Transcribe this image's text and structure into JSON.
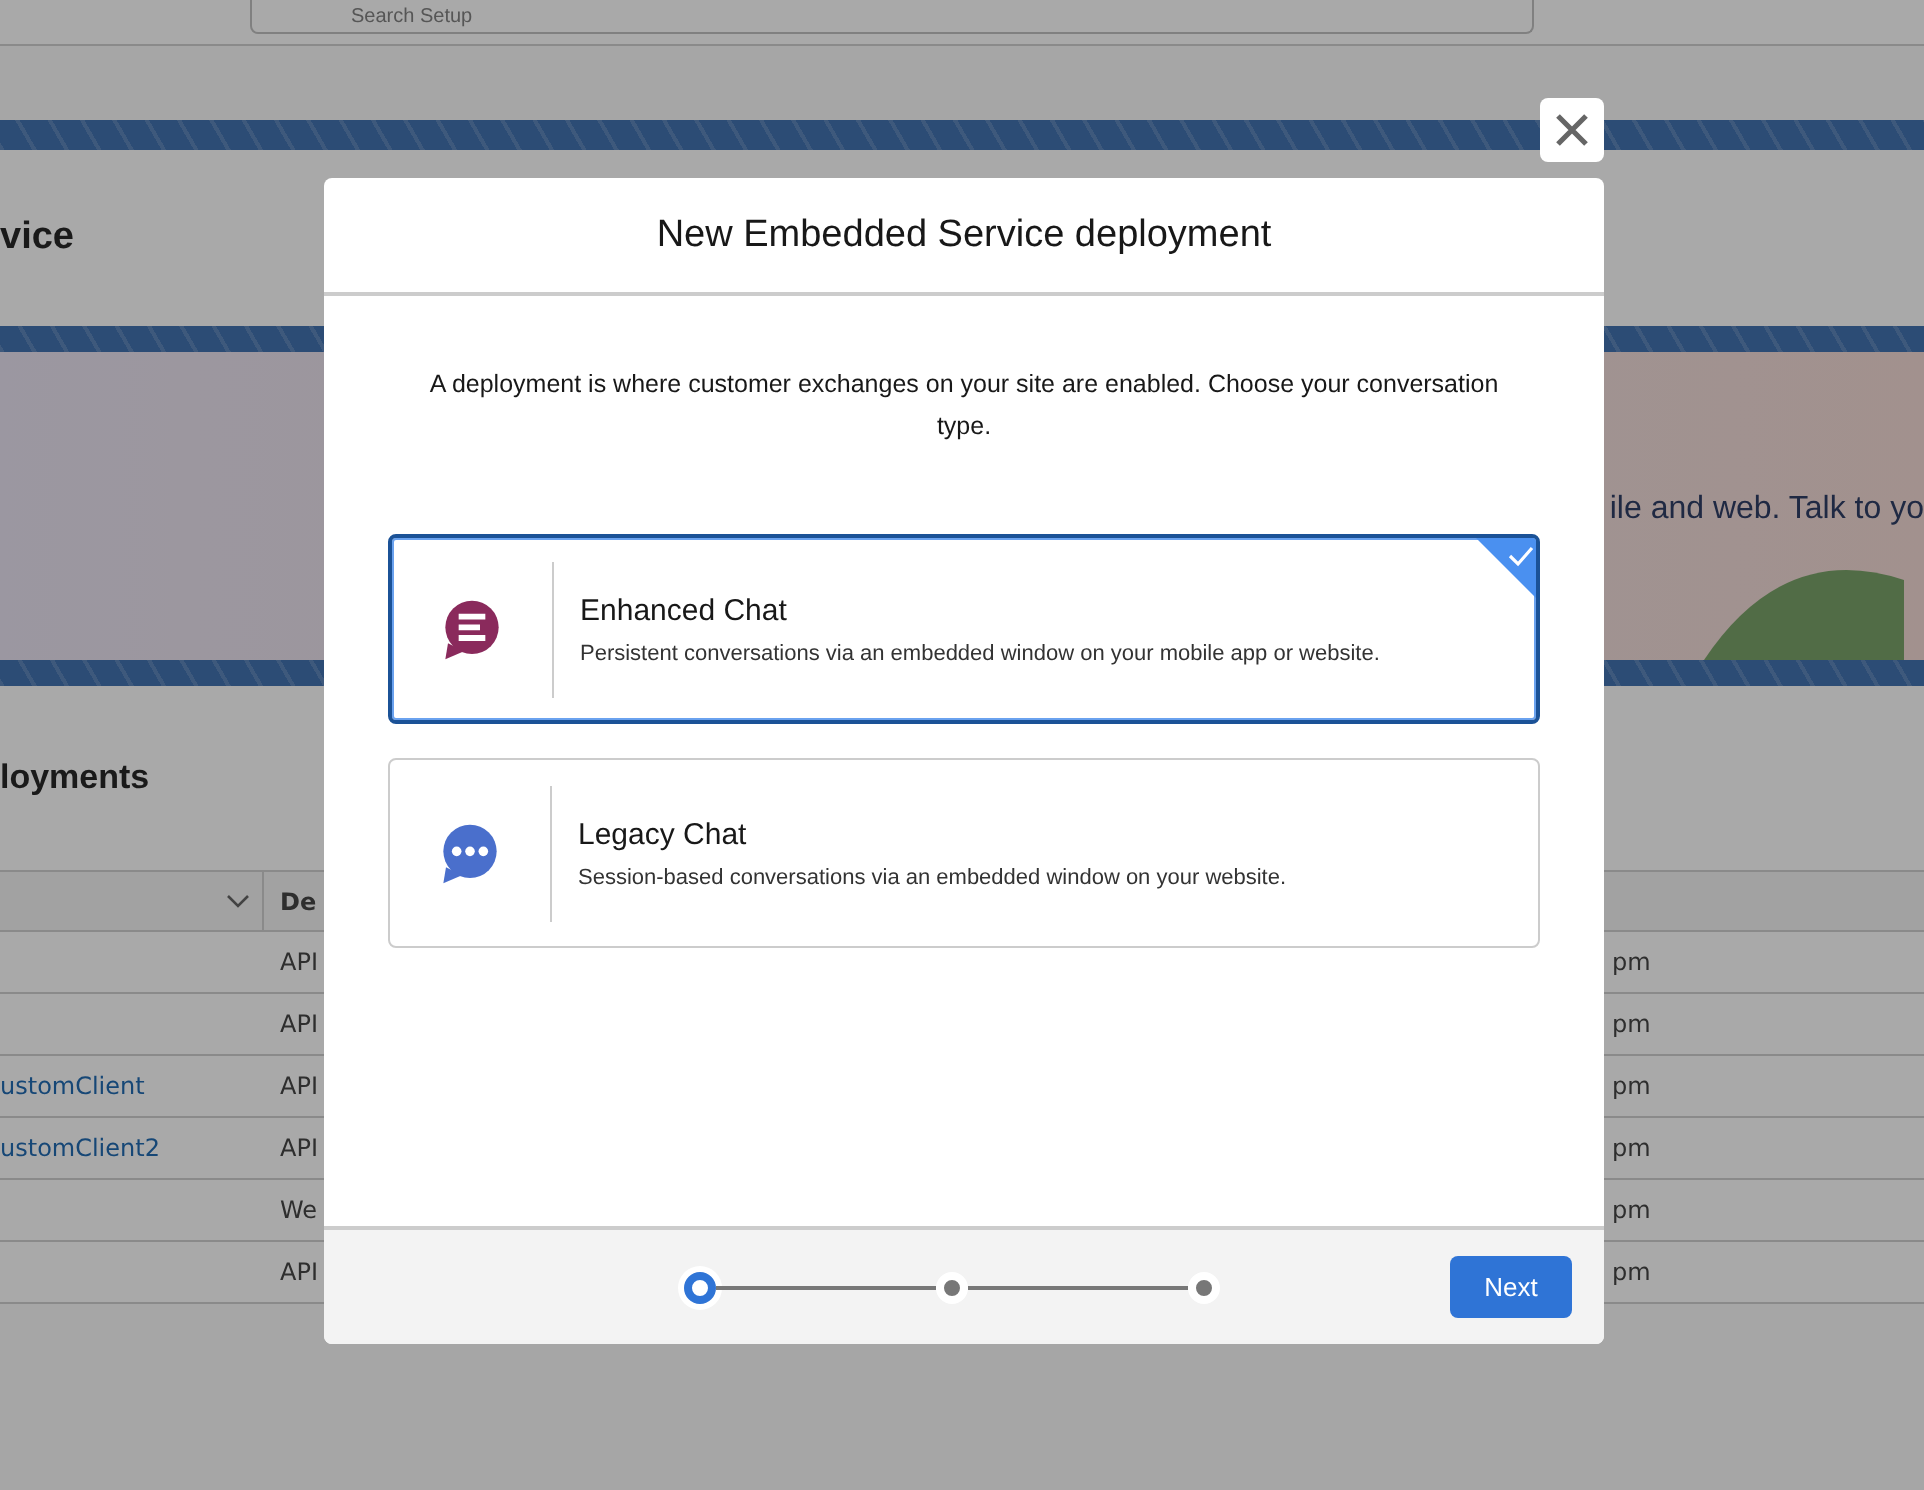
{
  "page": {
    "search": {
      "placeholder": "Search Setup"
    },
    "title": "vice",
    "banner_text": "ile and web. Talk to yo",
    "section_title": "loyments",
    "table": {
      "column_2": "De",
      "rows": [
        {
          "column_2": "API",
          "column_3": "pm"
        },
        {
          "column_2": "API",
          "column_3": "pm"
        },
        {
          "column_1": "ustomClient",
          "column_2": "API",
          "column_3": "pm"
        },
        {
          "column_1": "ustomClient2",
          "column_2": "API",
          "column_3": "pm"
        },
        {
          "column_2": "We",
          "column_3": "pm"
        },
        {
          "column_2": "API",
          "column_3": "pm"
        }
      ]
    }
  },
  "modal": {
    "title": "New Embedded Service deployment",
    "description": "A deployment is where customer exchanges on your site are enabled. Choose your conversation type.",
    "options": [
      {
        "kind": "enhanced",
        "title": "Enhanced Chat",
        "description": "Persistent conversations via an embedded window on your mobile app or website.",
        "selected": true
      },
      {
        "kind": "legacy",
        "title": "Legacy Chat",
        "description": "Session-based conversations via an embedded window on your website.",
        "selected": false
      }
    ],
    "steps": [
      {
        "selected": true
      },
      {
        "selected": false
      },
      {
        "selected": false
      }
    ],
    "button": "Next"
  }
}
